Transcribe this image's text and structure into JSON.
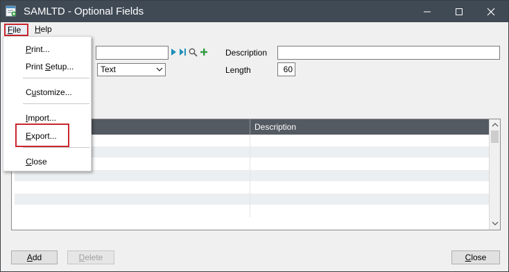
{
  "window": {
    "title": "SAMLTD - Optional Fields",
    "controls": {
      "minimize": "–",
      "maximize": "☐",
      "close": "✕"
    }
  },
  "menubar": {
    "file": "File",
    "file_accel": "F",
    "file_rest": "ile",
    "help": "Help",
    "help_accel": "H",
    "help_rest": "elp"
  },
  "file_menu": {
    "items": [
      {
        "label": "Print...",
        "accel": "P",
        "rest": "rint..."
      },
      {
        "label": "Print Setup...",
        "pre": "Print ",
        "accel": "S",
        "rest": "etup..."
      },
      {
        "label": "Customize...",
        "pre": "C",
        "accel": "u",
        "rest": "stomize..."
      },
      {
        "label": "Import...",
        "accel": "I",
        "rest": "mport..."
      },
      {
        "label": "Export...",
        "accel": "E",
        "rest": "xport..."
      },
      {
        "label": "Close",
        "accel": "C",
        "rest": "lose"
      }
    ]
  },
  "form": {
    "optional_field_value": "",
    "type_value": "Text",
    "description_label": "Description",
    "description_value": "",
    "length_label": "Length",
    "length_value": "60"
  },
  "grid": {
    "columns": [
      "",
      "Description"
    ],
    "rows": [
      [
        "",
        ""
      ],
      [
        "",
        ""
      ],
      [
        "",
        ""
      ],
      [
        "",
        ""
      ],
      [
        "",
        ""
      ],
      [
        "",
        ""
      ],
      [
        "",
        ""
      ]
    ]
  },
  "buttons": {
    "add_accel": "A",
    "add_rest": "dd",
    "delete_accel": "D",
    "delete_rest": "elete",
    "close_accel": "C",
    "close_rest": "lose"
  },
  "colors": {
    "titlebar": "#404a55",
    "grid_header": "#545a61",
    "highlight": "#c8262e",
    "accent_nav": "#1e8fb8",
    "accent_add": "#2e9b3d"
  }
}
